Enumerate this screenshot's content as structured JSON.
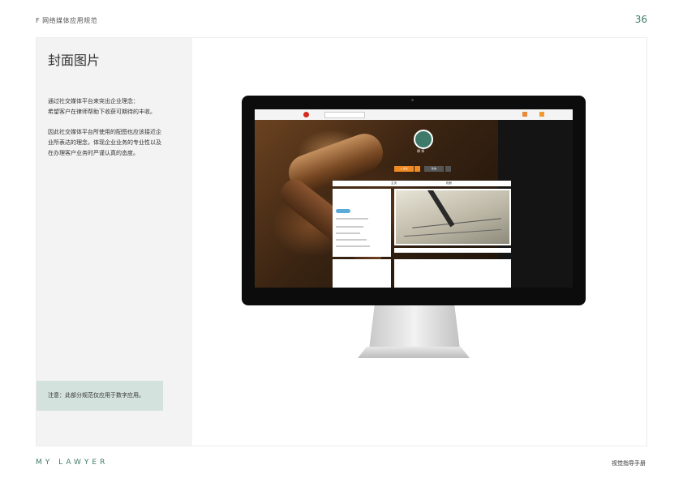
{
  "header": {
    "section": "F   网络媒体应用规范",
    "page_number": "36"
  },
  "content": {
    "title": "封面图片",
    "paragraph1": "通过社交媒体平台来突出企业理念：\n希望客户在律师帮助下收获可期待的丰收。",
    "paragraph2": "因此社交媒体平台所使用的配图也应该接近企\n业所表达的理念，体现企业业务的专业性以及\n在办理客户业务时严谨认真的态度。",
    "note": "注意：此部分规范仅应用于数字应用。"
  },
  "footer": {
    "brand": "MY LAWYER",
    "doc_title": "视觉指导手册"
  },
  "mockup": {
    "profile_name": "律 师",
    "follow_label": "+ 关注",
    "message_label": "私信",
    "tab_home": "主页",
    "tab_album": "相册"
  },
  "colors": {
    "brand": "#3e7a6a",
    "note_bg": "#d4e2de",
    "sidebar_bg": "#f3f3f3"
  }
}
